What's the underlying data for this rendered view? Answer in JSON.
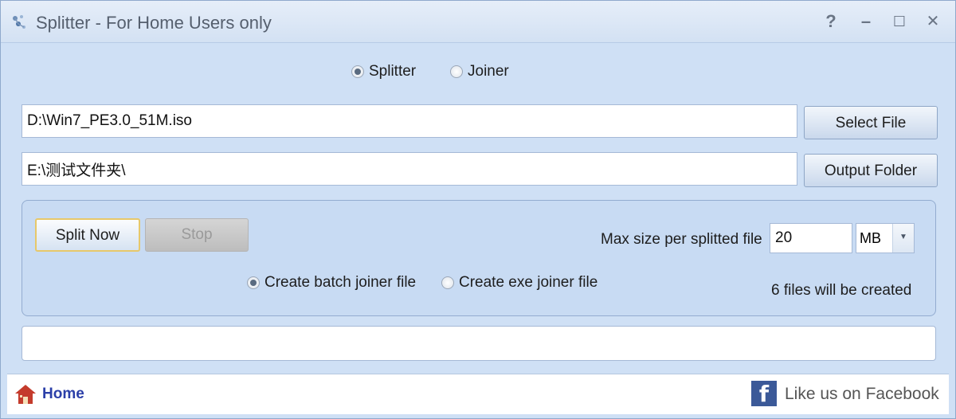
{
  "window": {
    "title": "Splitter - For Home Users only",
    "help_label": "?",
    "minimize_label": "–",
    "maximize_label": "☐",
    "close_label": "✕",
    "app_icon": "splitter-icon"
  },
  "mode": {
    "options": [
      {
        "label": "Splitter",
        "selected": true
      },
      {
        "label": "Joiner",
        "selected": false
      }
    ]
  },
  "source": {
    "value": "D:\\Win7_PE3.0_51M.iso",
    "button_label": "Select File"
  },
  "output": {
    "value": "E:\\测试文件夹\\",
    "button_label": "Output Folder"
  },
  "panel": {
    "split_label": "Split Now",
    "stop_label": "Stop",
    "max_size_label": "Max size per splitted file",
    "max_size_value": "20",
    "unit_selected": "MB",
    "joiner_options": [
      {
        "label": "Create batch joiner file",
        "selected": true
      },
      {
        "label": "Create exe joiner file",
        "selected": false
      }
    ],
    "files_info": "6 files will be created"
  },
  "progress": {
    "value": 0
  },
  "footer": {
    "home_label": "Home",
    "facebook_label": "Like us on Facebook",
    "facebook_icon": "facebook-icon",
    "home_icon": "home-icon"
  },
  "colors": {
    "window_bg": "#cfe0f5",
    "link_blue": "#2b3fa8",
    "facebook_blue": "#3b5998"
  }
}
